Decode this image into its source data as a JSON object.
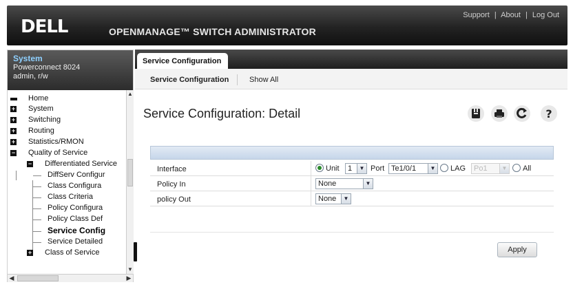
{
  "header": {
    "logo": "DELL",
    "app_title": "OPENMANAGE™ SWITCH ADMINISTRATOR",
    "links": [
      "Support",
      "About",
      "Log Out"
    ],
    "link_separator": "|"
  },
  "system_box": {
    "title": "System",
    "model": "Powerconnect 8024",
    "user": "admin, r/w"
  },
  "nav_tree": [
    {
      "label": "Home",
      "icon": "home-icon"
    },
    {
      "label": "System",
      "toggle": "+"
    },
    {
      "label": "Switching",
      "toggle": "+"
    },
    {
      "label": "Routing",
      "toggle": "+"
    },
    {
      "label": "Statistics/RMON",
      "toggle": "+"
    },
    {
      "label": "Quality of Service",
      "toggle": "−"
    },
    {
      "label": "Differentiated Service",
      "toggle": "−"
    },
    {
      "label": "DiffServ Configur"
    },
    {
      "label": "Class Configura"
    },
    {
      "label": "Class Criteria"
    },
    {
      "label": "Policy Configura"
    },
    {
      "label": "Policy Class Def"
    },
    {
      "label": "Service Config",
      "selected": true
    },
    {
      "label": "Service Detailed"
    },
    {
      "label": "Class of Service",
      "toggle": "+"
    }
  ],
  "tabs": {
    "main": "Service Configuration",
    "sub": [
      "Service Configuration",
      "Show All"
    ]
  },
  "page": {
    "title": "Service Configuration: Detail",
    "tool_icons": [
      "save-icon",
      "print-icon",
      "refresh-icon",
      "help-icon"
    ]
  },
  "form": {
    "interface": {
      "label": "Interface",
      "unit_label": "Unit",
      "unit_value": "1",
      "port_label": "Port",
      "port_value": "Te1/0/1",
      "lag_label": "LAG",
      "lag_value": "Po1",
      "all_label": "All",
      "selected_option": "Unit"
    },
    "policy_in": {
      "label": "Policy In",
      "value": "None"
    },
    "policy_out": {
      "label": "policy Out",
      "value": "None"
    }
  },
  "apply_button": "Apply",
  "colors": {
    "header_bg": "#1f1f1f",
    "system_title": "#8fd0ff",
    "form_header": "#c6d6ea",
    "radio_on": "#2a8a2a"
  }
}
